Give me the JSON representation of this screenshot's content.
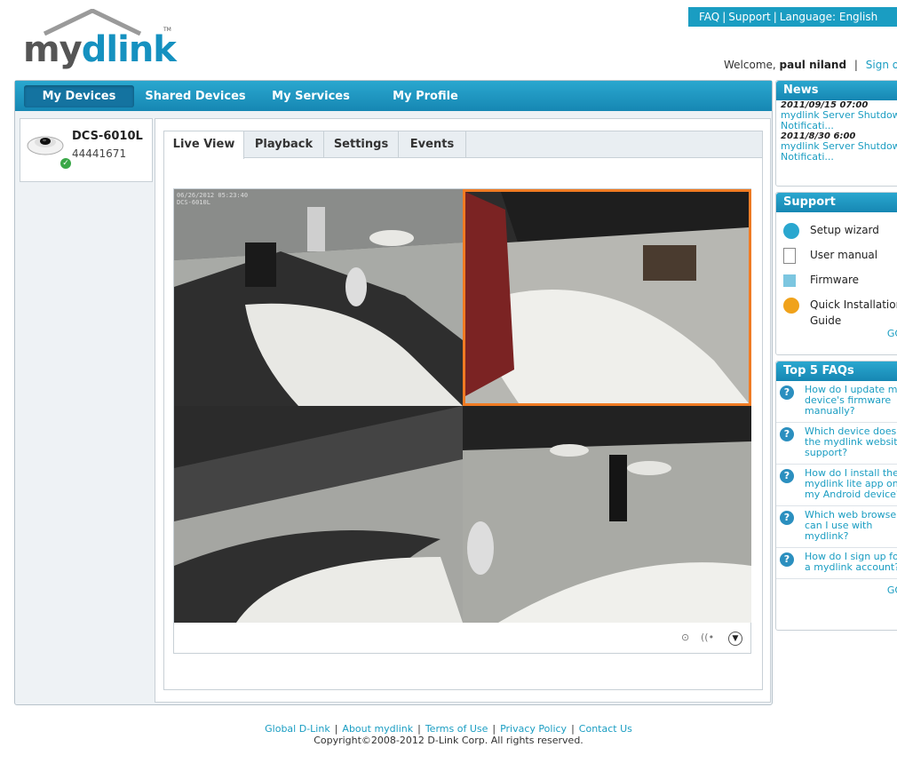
{
  "toplinks": {
    "faq": "FAQ",
    "support": "Support",
    "language": "Language: English"
  },
  "brand": {
    "my": "my",
    "dlink": "dlink",
    "tm": "TM",
    "accent": "#1591c0"
  },
  "welcome": {
    "prefix": "Welcome,",
    "user": "paul niland",
    "signout": "Sign out"
  },
  "nav": {
    "items": [
      "My Devices",
      "Shared Devices",
      "My Services",
      "My Profile"
    ],
    "active": "My Devices"
  },
  "device": {
    "name": "DCS-6010L",
    "id": "44441671",
    "status": "online",
    "icon": "fisheye-camera-icon"
  },
  "tabs": [
    "Live View",
    "Playback",
    "Settings",
    "Events"
  ],
  "video": {
    "osd_line1": "06/26/2012 05:23:40",
    "osd_line2": "DCS-6010L",
    "controls": [
      "record-icon",
      "audio-icon",
      "expand-down-icon"
    ]
  },
  "news": {
    "title": "News",
    "items": [
      {
        "date": "2011/09/15 07:00",
        "title": "mydlink Server Shutdown Notificati..."
      },
      {
        "date": "2011/8/30 6:00",
        "title": "mydlink Server Shutdown Notificati..."
      }
    ]
  },
  "support": {
    "title": "Support",
    "items": [
      "Setup wizard",
      "User manual",
      "Firmware",
      "Quick Installation Guide"
    ],
    "go": "GO"
  },
  "faqs": {
    "title": "Top 5 FAQs",
    "items": [
      "How do I update my device's firmware manually?",
      "Which device does the mydlink website support?",
      "How do I install the mydlink lite app on my Android device?",
      "Which web browsers can I use with mydlink?",
      "How do I sign up for a mydlink account?"
    ],
    "go": "GO"
  },
  "footer": {
    "links": [
      "Global D-Link",
      "About mydlink",
      "Terms of Use",
      "Privacy Policy",
      "Contact Us"
    ],
    "copyright": "Copyright©2008-2012 D-Link Corp. All rights reserved."
  }
}
